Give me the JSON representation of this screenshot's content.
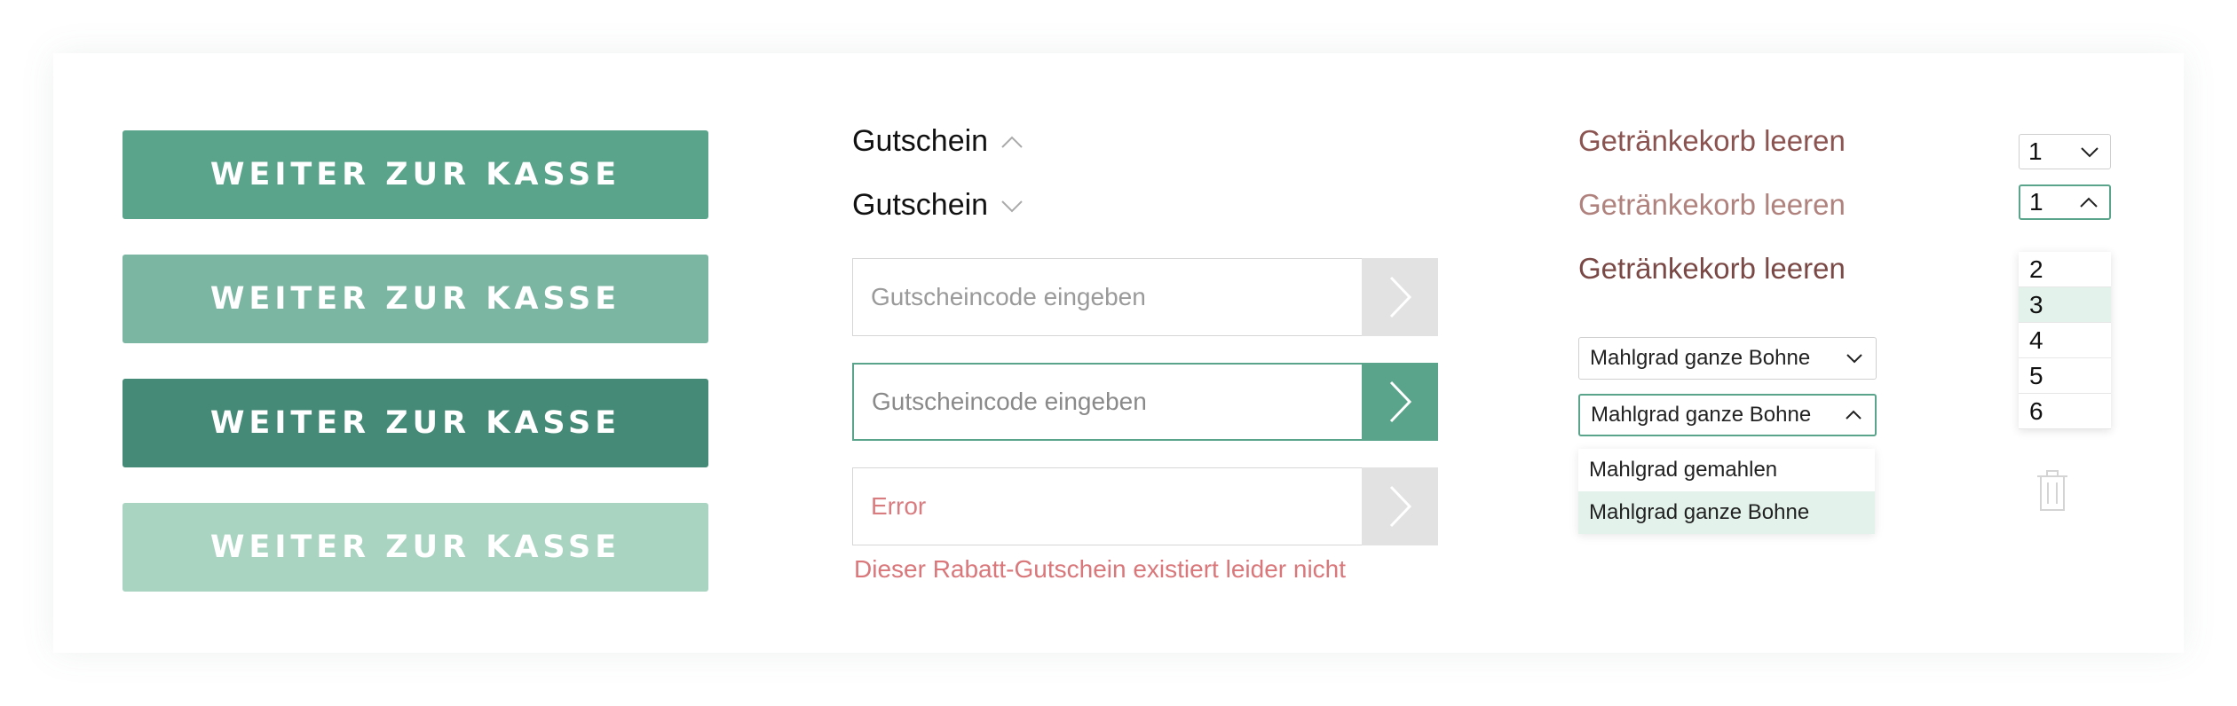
{
  "buttons": {
    "checkout_label": "WEITER ZUR KASSE",
    "variants": [
      "default",
      "hover",
      "active",
      "disabled"
    ],
    "colors": {
      "default": "#5aa48c",
      "hover": "#7bb6a3",
      "active": "#458a76",
      "disabled": "#a8d4c1"
    }
  },
  "coupon": {
    "toggle_label": "Gutschein",
    "placeholder": "Gutscheincode eingeben",
    "error_value": "Error",
    "error_message": "Dieser Rabatt-Gutschein existiert leider nicht"
  },
  "cart": {
    "clear_label": "Getränkekorb leeren",
    "link_colors": [
      "#8b5451",
      "#b0827e",
      "#7a4946"
    ]
  },
  "grind": {
    "selected": "Mahlgrad ganze Bohne",
    "options": [
      "Mahlgrad gemahlen",
      "Mahlgrad ganze Bohne"
    ]
  },
  "quantity": {
    "selected": "1",
    "options": [
      "2",
      "3",
      "4",
      "5",
      "6"
    ]
  },
  "icons": {
    "chevron_up": "chevron-up-icon",
    "chevron_down": "chevron-down-icon",
    "chevron_right": "chevron-right-icon",
    "trash": "trash-icon"
  },
  "colors": {
    "accent": "#5aa48c",
    "error": "#d9777a",
    "selected_bg": "#e3f3ec"
  }
}
